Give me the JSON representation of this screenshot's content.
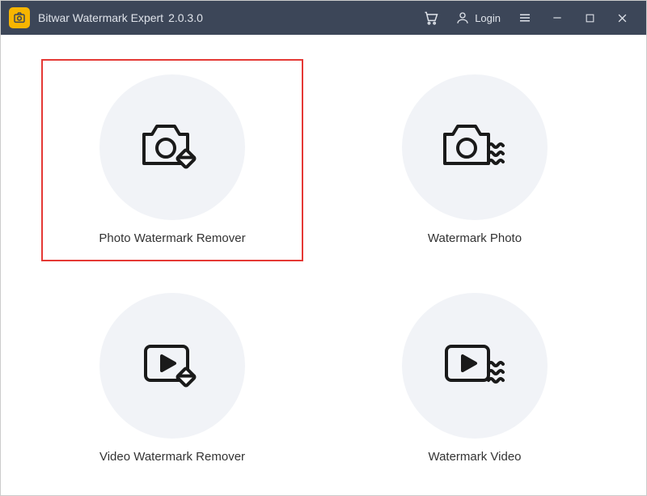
{
  "app": {
    "name": "Bitwar Watermark Expert",
    "version": "2.0.3.0"
  },
  "titlebar": {
    "login_label": "Login"
  },
  "tiles": [
    {
      "label": "Photo Watermark Remover"
    },
    {
      "label": "Watermark Photo"
    },
    {
      "label": "Video Watermark Remover"
    },
    {
      "label": "Watermark Video"
    }
  ]
}
